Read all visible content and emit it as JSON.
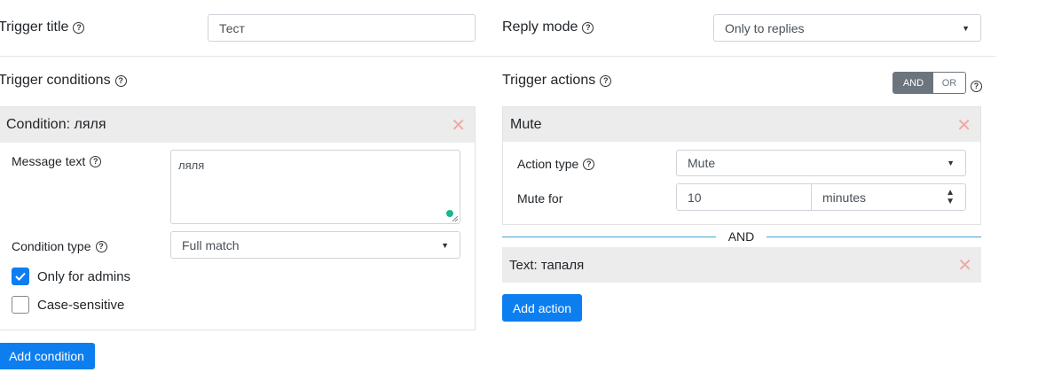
{
  "trigger_title": {
    "label": "Trigger title",
    "value": "Тест"
  },
  "reply_mode": {
    "label": "Reply mode",
    "value": "Only to replies"
  },
  "conditions": {
    "heading": "Trigger conditions",
    "card_title": "Condition: ляля",
    "message_text_label": "Message text",
    "message_text_value": "ляля",
    "condition_type_label": "Condition type",
    "condition_type_value": "Full match",
    "only_admins_label": "Only for admins",
    "only_admins_checked": true,
    "case_sensitive_label": "Case-sensitive",
    "case_sensitive_checked": false,
    "add_button": "Add condition"
  },
  "actions": {
    "heading": "Trigger actions",
    "toggle_and": "AND",
    "toggle_or": "OR",
    "mute_card_title": "Mute",
    "action_type_label": "Action type",
    "action_type_value": "Mute",
    "mute_for_label": "Mute for",
    "mute_for_value": "10",
    "mute_unit_value": "minutes",
    "separator": "AND",
    "text_card_title": "Text: тапаля",
    "add_button": "Add action"
  },
  "colors": {
    "primary": "#0d7ef0",
    "toggle_active": "#6c757d",
    "separator": "#3ea4d6",
    "close": "#f0a9a3"
  }
}
